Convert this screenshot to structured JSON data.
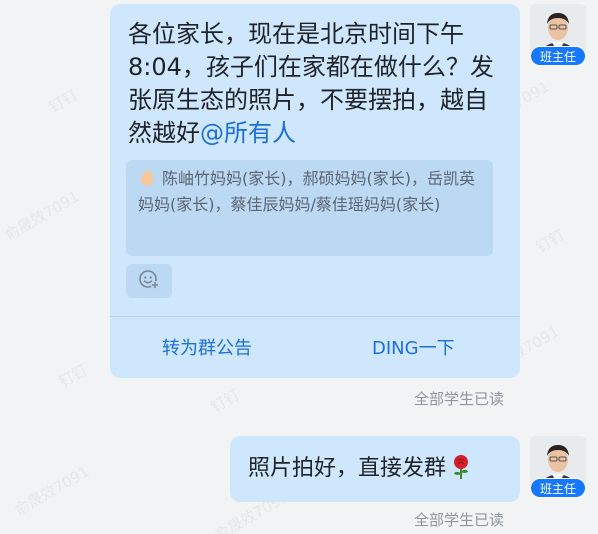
{
  "watermark_text": "俞晟效7091",
  "watermark_brand": "钉钉",
  "messages": [
    {
      "text": "各位家长，现在是北京时间下午8:04，孩子们在家都在做什么？发张原生态的照片，不要摆拍，越自然越好",
      "mention": "@所有人",
      "mentioned_users": "陈岫竹妈妈(家长)，郝硕妈妈(家长)，岳凯英妈妈(家长)，蔡佳辰妈妈/蔡佳瑶妈妈(家长)",
      "actions": {
        "announce": "转为群公告",
        "ding": "DING一下"
      },
      "read_status": "全部学生已读",
      "sender_tag": "班主任"
    },
    {
      "text": "照片拍好，直接发群",
      "emoji": "rose-icon",
      "read_status": "全部学生已读",
      "sender_tag": "班主任"
    }
  ],
  "colors": {
    "bubble": "#cfe7fc",
    "mention": "#1d6fd6",
    "tag": "#1677ff",
    "background": "#f2f3f5"
  }
}
